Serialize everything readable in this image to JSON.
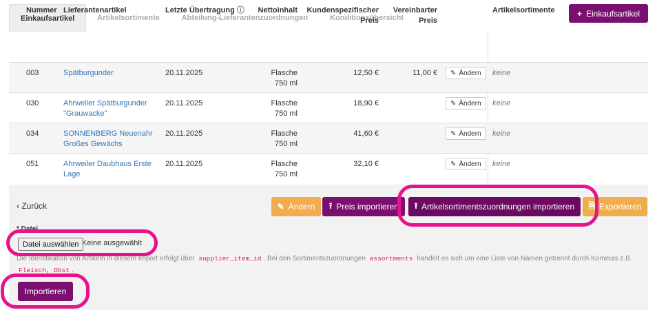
{
  "tabs": [
    {
      "label": "Einkaufsartikel",
      "active": true
    },
    {
      "label": "Artikelsortimente"
    },
    {
      "label": "Abteilung-Lieferantenzuordnungen"
    },
    {
      "label": "Konditionsübersicht"
    }
  ],
  "add_button": {
    "icon": "+",
    "label": "Einkaufsartikel"
  },
  "table": {
    "headers": {
      "number": "Nummer",
      "supplier_item": "Lieferantenartikel",
      "last_transfer": "Letzte Übertragung",
      "info_icon": "ⓘ",
      "net_content": "Nettoinhalt",
      "customer_price_1": "Kundenspezifischer",
      "customer_price_2": "Preis",
      "agreed_price_1": "Vereinbarter",
      "agreed_price_2": "Preis",
      "assortments": "Artikelsortimente"
    },
    "rows": [
      {
        "number": "003",
        "name_1": "Spätburgunder",
        "name_2": "",
        "date": "20.11.2025",
        "content_1": "Flasche",
        "content_2": "750 ml",
        "price": "12,50 €",
        "agreed": "11,00 €",
        "edit": "Ändern",
        "assortments": "keine"
      },
      {
        "number": "030",
        "name_1": "Ahrweiler Spätburgunder",
        "name_2": "\"Grauwacke\"",
        "date": "20.11.2025",
        "content_1": "Flasche",
        "content_2": "750 ml",
        "price": "18,90 €",
        "agreed": "",
        "edit": "Ändern",
        "assortments": "keine"
      },
      {
        "number": "034",
        "name_1": "SONNENBERG Neuenahr",
        "name_2": "Großes Gewächs",
        "date": "20.11.2025",
        "content_1": "Flasche",
        "content_2": "750 ml",
        "price": "41,60 €",
        "agreed": "",
        "edit": "Ändern",
        "assortments": "keine"
      },
      {
        "number": "051",
        "name_1": "Ahrweiler Daubhaus Erste",
        "name_2": "Lage",
        "date": "20.11.2025",
        "content_1": "Flasche",
        "content_2": "750 ml",
        "price": "32,10 €",
        "agreed": "",
        "edit": "Ändern",
        "assortments": "keine"
      }
    ]
  },
  "actions": {
    "back": "‹ Zurück",
    "edit": "Ändern",
    "edit_icon": "✎",
    "import_price": "Preis importieren",
    "import_icon": "⭱",
    "import_assortments": "Artikelsortimentszuordnungen importieren",
    "export": "Exportieren",
    "export_icon": "🗎"
  },
  "form": {
    "file_label": "* Datei",
    "file_button": "Datei auswählen",
    "file_status": "Keine ausgewählt",
    "help_1": "Die Identifikation von Artikeln in diesem Import erfolgt über",
    "help_code_1": "supplier_item_id",
    "help_2": ". Bei den Sortimentszuordnungen",
    "help_code_2": "assortments",
    "help_3": "handelt es sich um eine Liste von Namen getrennt durch Kommas z.B.",
    "help_code_3": "Fleisch, Obst",
    "help_4": ".",
    "submit": "Importieren"
  },
  "colors": {
    "brand_purple": "#7b0f6f",
    "highlight": "#e6138c",
    "warning_orange": "#f0ad4e",
    "link_blue": "#3377bb"
  }
}
